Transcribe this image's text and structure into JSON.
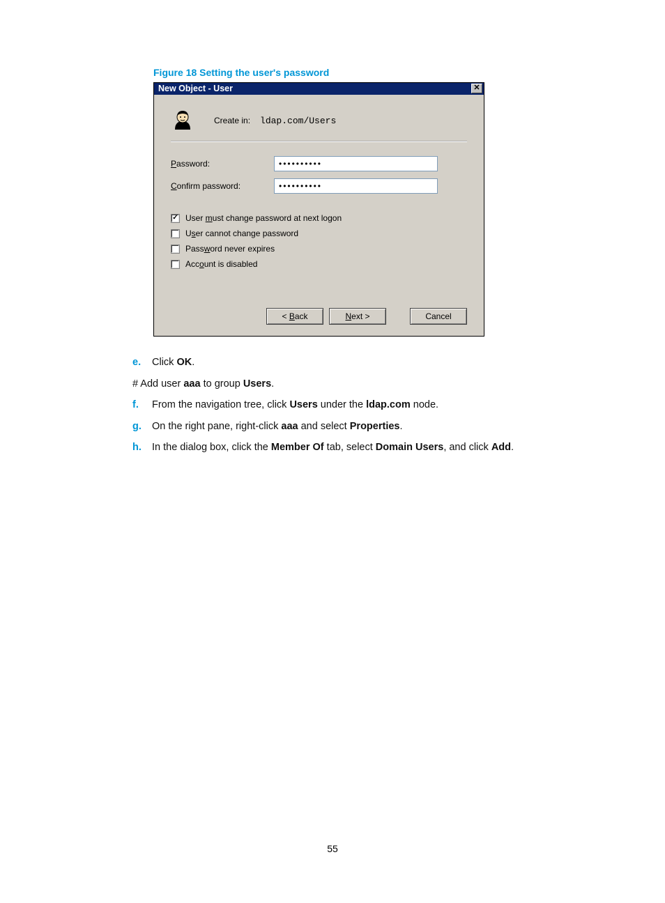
{
  "figure_caption": "Figure 18 Setting the user's password",
  "dialog": {
    "title": "New Object - User",
    "close_glyph": "✕",
    "create_in_label": "Create in:",
    "create_in_path": "ldap.com/Users",
    "password_label_pre": "P",
    "password_label_post": "assword:",
    "confirm_label_pre": "C",
    "confirm_label_post": "onfirm password:",
    "password_value": "••••••••••",
    "confirm_value": "••••••••••",
    "chk1_pre": "User ",
    "chk1_u": "m",
    "chk1_post": "ust change password at next logon",
    "chk1_checked": true,
    "chk2_pre": "U",
    "chk2_u": "s",
    "chk2_post": "er cannot change password",
    "chk2_checked": false,
    "chk3_pre": "Pass",
    "chk3_u": "w",
    "chk3_post": "ord never expires",
    "chk3_checked": false,
    "chk4_pre": "Acc",
    "chk4_u": "o",
    "chk4_post": "unt is disabled",
    "chk4_checked": false,
    "back_pre": "< ",
    "back_u": "B",
    "back_post": "ack",
    "next_u": "N",
    "next_post": "ext >",
    "cancel": "Cancel"
  },
  "steps": {
    "e_marker": "e.",
    "e_text_pre": "Click ",
    "e_bold": "OK",
    "e_text_post": ".",
    "note_pre": "# Add user ",
    "note_b1": "aaa",
    "note_mid": " to group ",
    "note_b2": "Users",
    "note_post": ".",
    "f_marker": "f.",
    "f_pre": "From the navigation tree, click ",
    "f_b1": "Users",
    "f_mid": " under the ",
    "f_b2": "ldap.com",
    "f_post": " node.",
    "g_marker": "g.",
    "g_pre": "On the right pane, right-click ",
    "g_b1": "aaa",
    "g_mid": " and select ",
    "g_b2": "Properties",
    "g_post": ".",
    "h_marker": "h.",
    "h_pre": "In the dialog box, click the ",
    "h_b1": "Member Of",
    "h_mid1": " tab, select ",
    "h_b2": "Domain Users",
    "h_mid2": ", and click ",
    "h_b3": "Add",
    "h_post": "."
  },
  "page_number": "55"
}
